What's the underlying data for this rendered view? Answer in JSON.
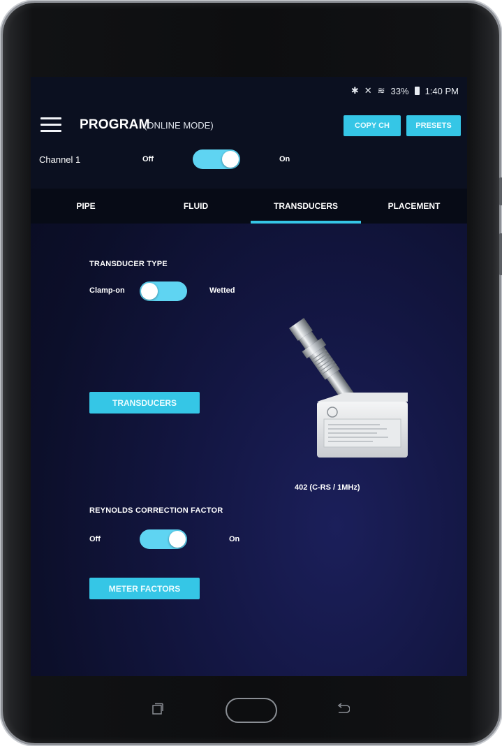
{
  "status_bar": {
    "battery": "33%",
    "time": "1:40 PM",
    "bluetooth_icon": "bluetooth-icon",
    "mute_icon": "vibrate-mute-icon",
    "wifi_icon": "wifi-icon",
    "battery_icon": "battery-icon"
  },
  "header": {
    "title": "PROGRAM",
    "subtitle": "(ONLINE MODE)",
    "copy_button": "COPY CH",
    "presets_button": "PRESETS"
  },
  "channel": {
    "label": "Channel 1",
    "off_label": "Off",
    "on_label": "On",
    "enabled": true
  },
  "tabs": [
    {
      "label": "PIPE",
      "active": false
    },
    {
      "label": "FLUID",
      "active": false
    },
    {
      "label": "TRANSDUCERS",
      "active": true
    },
    {
      "label": "PLACEMENT",
      "active": false
    }
  ],
  "transducer_type": {
    "title": "TRANSDUCER TYPE",
    "left_label": "Clamp-on",
    "right_label": "Wetted",
    "value": "Clamp-on"
  },
  "transducers_button": "TRANSDUCERS",
  "transducer_caption": "402 (C-RS / 1MHz)",
  "reynolds": {
    "title": "REYNOLDS CORRECTION FACTOR",
    "off_label": "Off",
    "on_label": "On",
    "enabled": true
  },
  "meter_factors_button": "METER FACTORS",
  "colors": {
    "accent": "#35c6e6",
    "switch_track": "#5fd4f2",
    "app_bar": "#0b1020",
    "screen_bg": "#0c0f2a"
  }
}
